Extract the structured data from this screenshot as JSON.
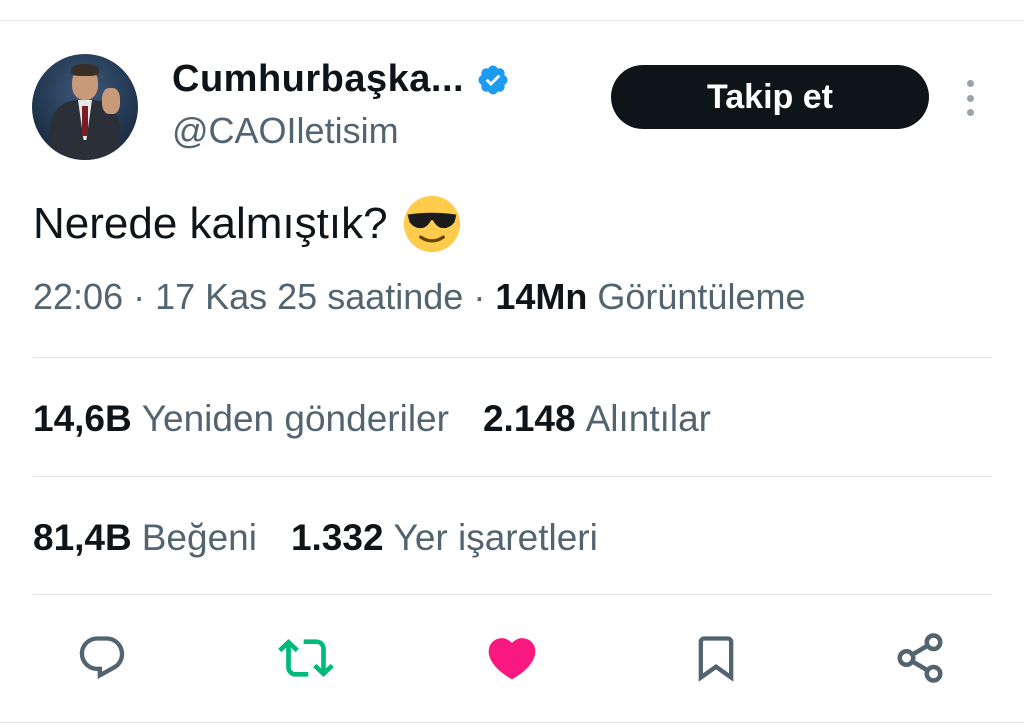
{
  "profile": {
    "name": "Cumhurbaşka...",
    "handle": "@CAOIletisim",
    "follow_label": "Takip et"
  },
  "tweet": {
    "text": "Nerede kalmıştık?",
    "emoji": "smiling-face-with-sunglasses",
    "time": "22:06 · 17 Kas 25 saatinde ·",
    "views_count": "14Mn",
    "views_label": "Görüntüleme"
  },
  "stats": {
    "retweets": {
      "count": "14,6B",
      "label": "Yeniden gönderiler"
    },
    "quotes": {
      "count": "2.148",
      "label": "Alıntılar"
    },
    "likes": {
      "count": "81,4B",
      "label": "Beğeni"
    },
    "bookmarks": {
      "count": "1.332",
      "label": "Yer işaretleri"
    }
  },
  "actions": {
    "icons": [
      "reply-icon",
      "retweet-icon",
      "like-icon",
      "bookmark-icon",
      "share-icon"
    ],
    "colors": {
      "retweet": "#00ba7c",
      "like": "#f91880",
      "default": "#536471"
    }
  },
  "colors": {
    "verified": "#1d9bf0",
    "follow_bg": "#0f1419",
    "text_primary": "#0f1419",
    "text_secondary": "#536471"
  }
}
